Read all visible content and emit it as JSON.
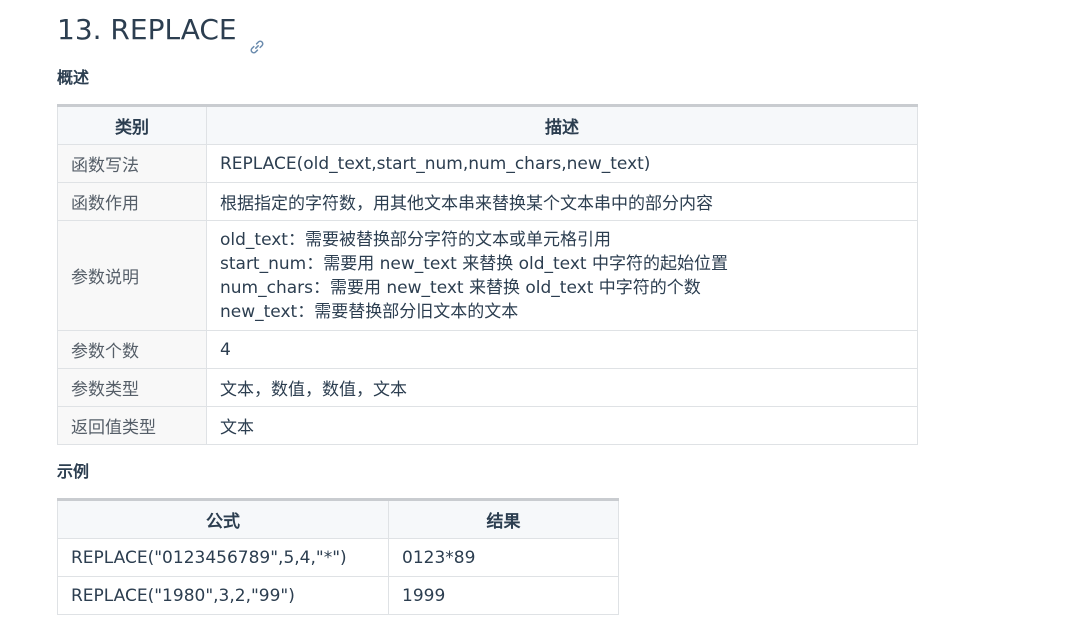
{
  "header": {
    "title": "13. REPLACE",
    "anchor_icon": "link-icon"
  },
  "overview": {
    "heading": "概述",
    "columns": [
      "类别",
      "描述"
    ],
    "rows": [
      {
        "label": "函数写法",
        "value": "REPLACE(old_text,start_num,num_chars,new_text)"
      },
      {
        "label": "函数作用",
        "value": "根据指定的字符数，用其他文本串来替换某个文本串中的部分内容"
      },
      {
        "label": "参数说明",
        "lines": [
          "old_text：需要被替换部分字符的文本或单元格引用",
          "start_num：需要用 new_text 来替换 old_text 中字符的起始位置",
          "num_chars：需要用 new_text 来替换 old_text 中字符的个数",
          "new_text：需要替换部分旧文本的文本"
        ]
      },
      {
        "label": "参数个数",
        "value": "4"
      },
      {
        "label": "参数类型",
        "value": "文本，数值，数值，文本"
      },
      {
        "label": "返回值类型",
        "value": "文本"
      }
    ]
  },
  "examples": {
    "heading": "示例",
    "columns": [
      "公式",
      "结果"
    ],
    "rows": [
      {
        "formula": "REPLACE(\"0123456789\",5,4,\"*\")",
        "result": "0123*89"
      },
      {
        "formula": "REPLACE(\"1980\",3,2,\"99\")",
        "result": "1999"
      }
    ]
  }
}
